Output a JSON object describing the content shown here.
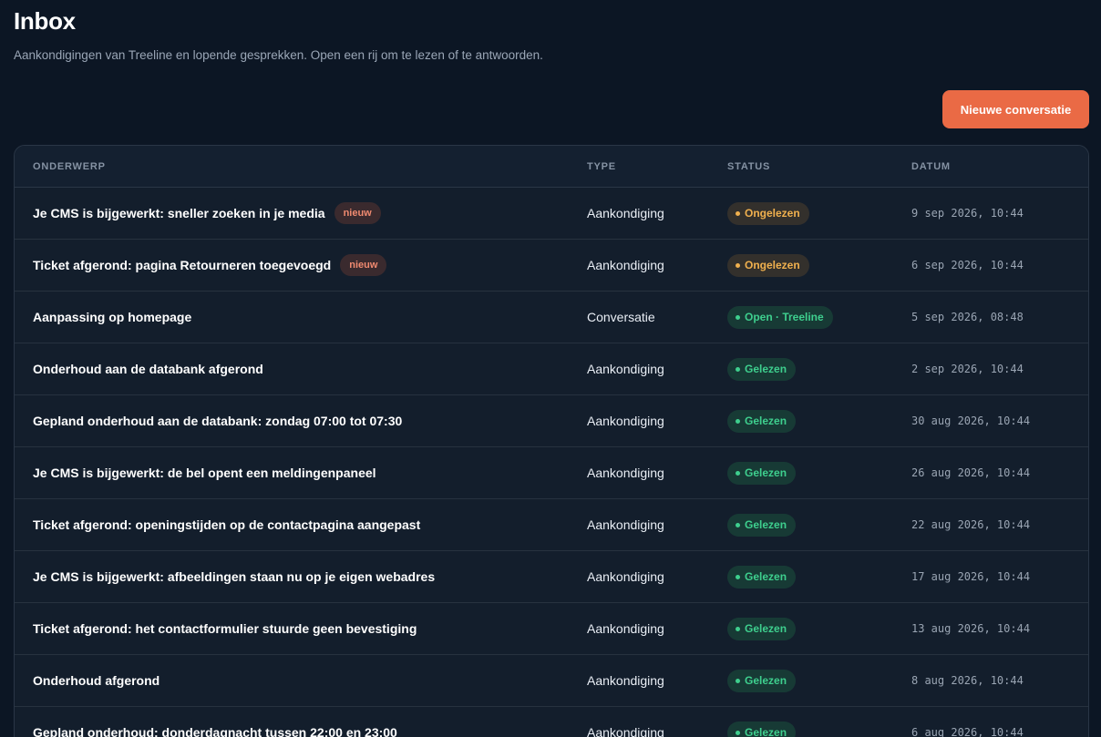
{
  "header": {
    "title": "Inbox",
    "subtitle": "Aankondigingen van Treeline en lopende gesprekken. Open een rij om te lezen of te antwoorden.",
    "new_button_label": "Nieuwe conversatie"
  },
  "table": {
    "columns": [
      "ONDERWERP",
      "TYPE",
      "STATUS",
      "DATUM"
    ],
    "new_badge_label": "nieuw",
    "rows": [
      {
        "subject": "Je CMS is bijgewerkt: sneller zoeken in je media",
        "is_new": true,
        "type": "Aankondiging",
        "status": "Ongelezen",
        "status_kind": "unread",
        "date": "9 sep 2026, 10:44"
      },
      {
        "subject": "Ticket afgerond: pagina Retourneren toegevoegd",
        "is_new": true,
        "type": "Aankondiging",
        "status": "Ongelezen",
        "status_kind": "unread",
        "date": "6 sep 2026, 10:44"
      },
      {
        "subject": "Aanpassing op homepage",
        "is_new": false,
        "type": "Conversatie",
        "status": "Open · Treeline",
        "status_kind": "read",
        "date": "5 sep 2026, 08:48"
      },
      {
        "subject": "Onderhoud aan de databank afgerond",
        "is_new": false,
        "type": "Aankondiging",
        "status": "Gelezen",
        "status_kind": "read",
        "date": "2 sep 2026, 10:44"
      },
      {
        "subject": "Gepland onderhoud aan de databank: zondag 07:00 tot 07:30",
        "is_new": false,
        "type": "Aankondiging",
        "status": "Gelezen",
        "status_kind": "read",
        "date": "30 aug 2026, 10:44"
      },
      {
        "subject": "Je CMS is bijgewerkt: de bel opent een meldingenpaneel",
        "is_new": false,
        "type": "Aankondiging",
        "status": "Gelezen",
        "status_kind": "read",
        "date": "26 aug 2026, 10:44"
      },
      {
        "subject": "Ticket afgerond: openingstijden op de contactpagina aangepast",
        "is_new": false,
        "type": "Aankondiging",
        "status": "Gelezen",
        "status_kind": "read",
        "date": "22 aug 2026, 10:44"
      },
      {
        "subject": "Je CMS is bijgewerkt: afbeeldingen staan nu op je eigen webadres",
        "is_new": false,
        "type": "Aankondiging",
        "status": "Gelezen",
        "status_kind": "read",
        "date": "17 aug 2026, 10:44"
      },
      {
        "subject": "Ticket afgerond: het contactformulier stuurde geen bevestiging",
        "is_new": false,
        "type": "Aankondiging",
        "status": "Gelezen",
        "status_kind": "read",
        "date": "13 aug 2026, 10:44"
      },
      {
        "subject": "Onderhoud afgerond",
        "is_new": false,
        "type": "Aankondiging",
        "status": "Gelezen",
        "status_kind": "read",
        "date": "8 aug 2026, 10:44"
      },
      {
        "subject": "Gepland onderhoud: donderdagnacht tussen 22:00 en 23:00",
        "is_new": false,
        "type": "Aankondiging",
        "status": "Gelezen",
        "status_kind": "read",
        "date": "6 aug 2026, 10:44"
      }
    ]
  },
  "colors": {
    "background": "#0c1624",
    "accent": "#ea6a45",
    "unread": "#f0b04e",
    "read": "#3ecf8e"
  }
}
